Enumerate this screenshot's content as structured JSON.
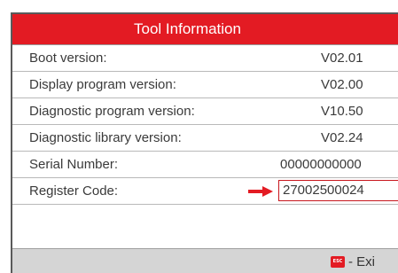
{
  "title": "Tool  Information",
  "rows": [
    {
      "label": "Boot version:",
      "value": "V02.01"
    },
    {
      "label": "Display program version:",
      "value": "V02.00"
    },
    {
      "label": "Diagnostic program version:",
      "value": "V10.50"
    },
    {
      "label": "Diagnostic library version:",
      "value": "V02.24"
    },
    {
      "label": "Serial Number:",
      "value": "00000000000"
    },
    {
      "label": "Register Code:",
      "value": "27002500024"
    }
  ],
  "footer": {
    "esc_icon_text": "ESC",
    "exit_label": "- Exi"
  },
  "colors": {
    "accent": "#e31b23",
    "footer_bg": "#d5d5d5",
    "text": "#3a3a3a"
  },
  "icons": {
    "arrow": "right-arrow-icon",
    "esc": "esc-key-icon"
  }
}
